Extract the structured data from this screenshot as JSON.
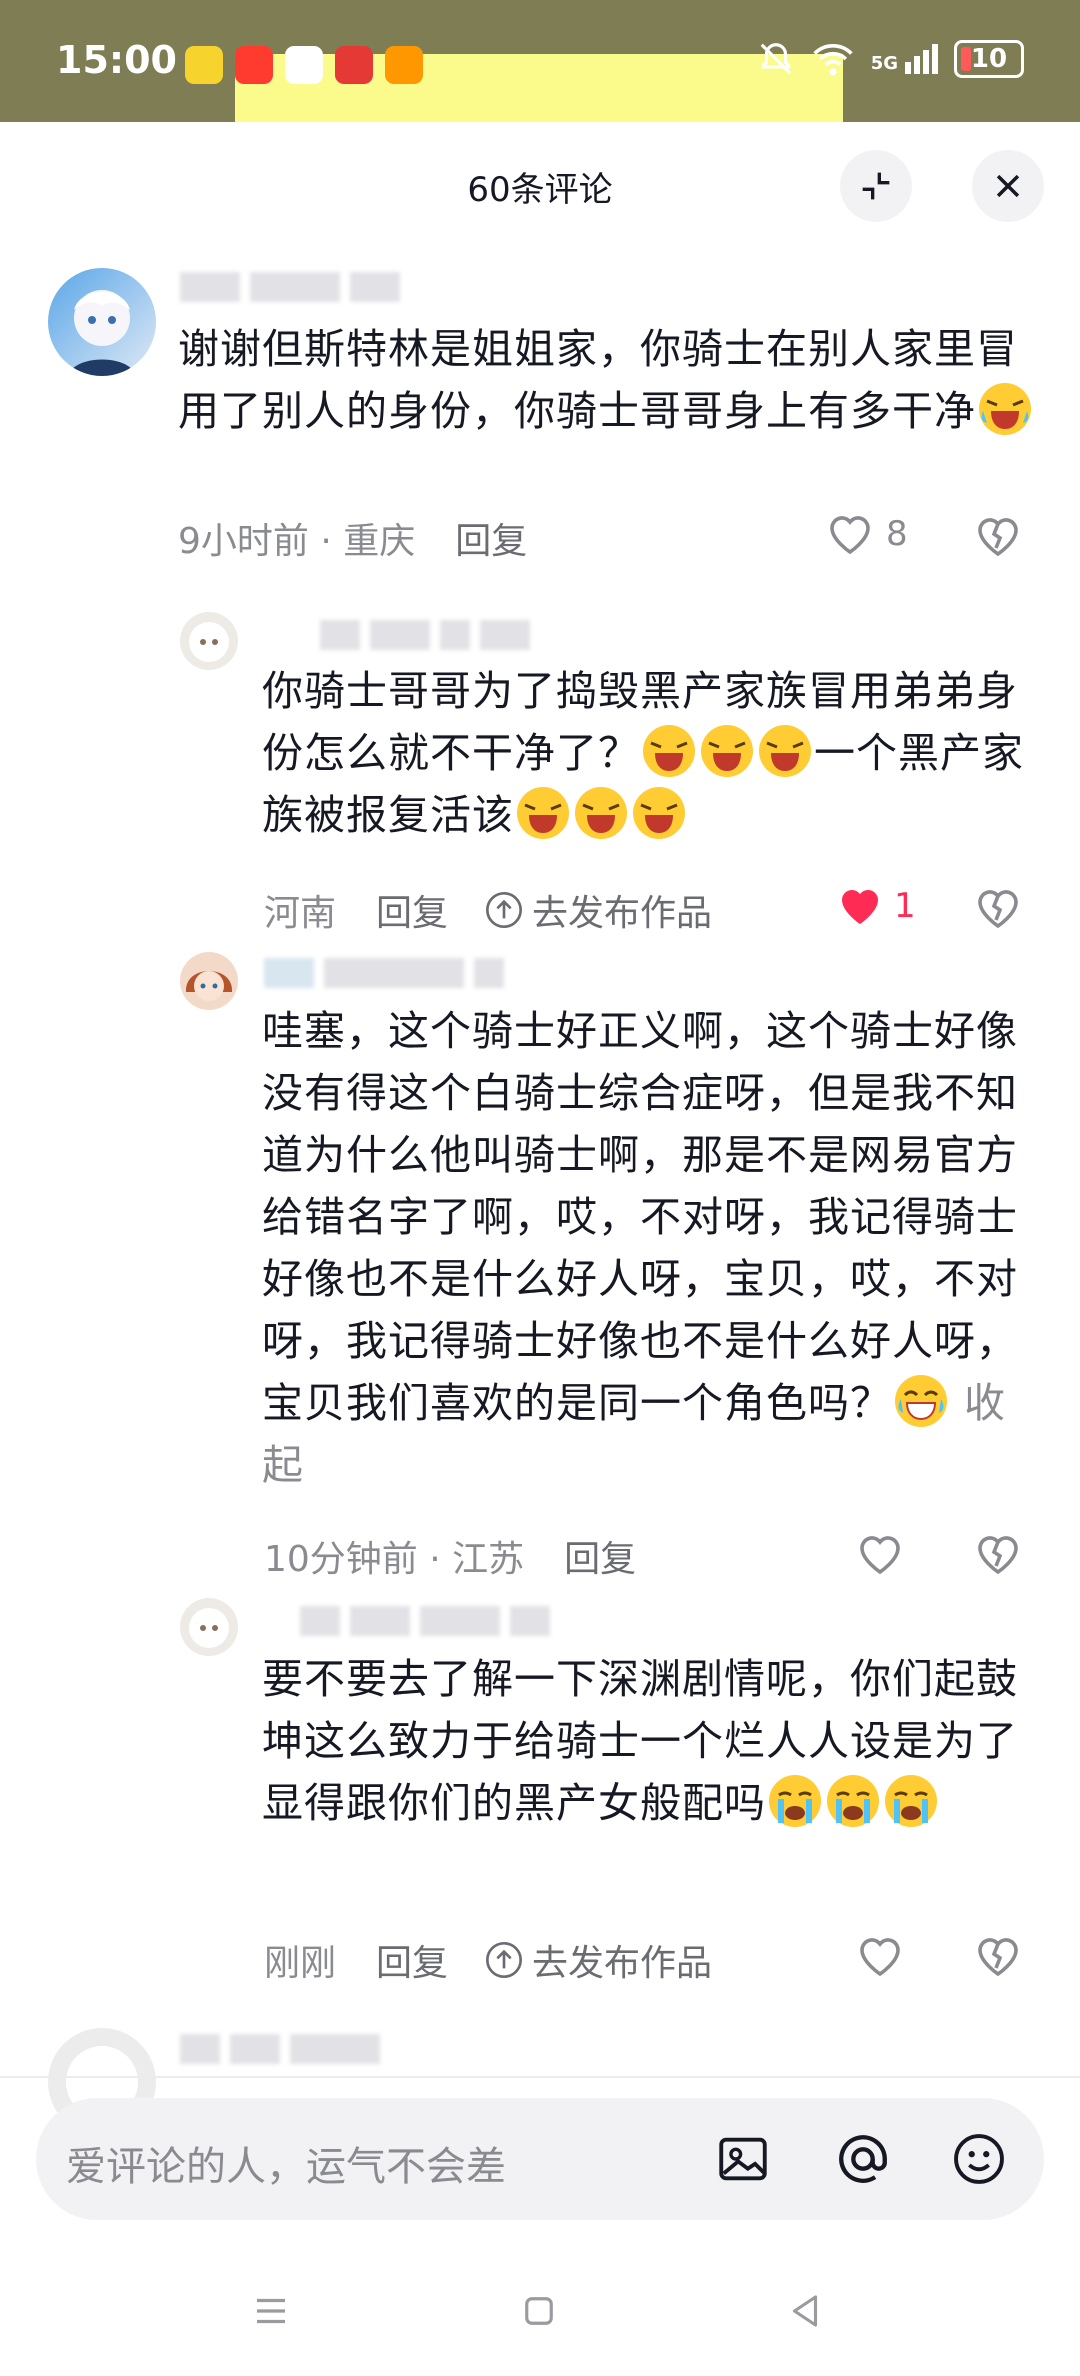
{
  "status_bar": {
    "time": "15:00",
    "network": "5G",
    "battery": "10",
    "app_icon_colors": [
      "#f6d32d",
      "#ff3b30",
      "#1e88e5",
      "#e53935",
      "#ff9800"
    ]
  },
  "sheet": {
    "title": "60条评论"
  },
  "comments": [
    {
      "text_parts": [
        "谢谢但斯特林是姐姐家，你骑士在别人家里冒用了别人的身份，你骑士哥哥身上有多干净"
      ],
      "time_location": "9小时前 · 重庆",
      "reply_label": "回复",
      "like_count": "8",
      "emoji": "laughing-crying-emoji"
    },
    {
      "text_part1": "你骑士哥哥为了捣毁黑产家族冒用弟弟身份怎么就不干净了？",
      "text_part2": "一个黑产家族被报复活该",
      "location": "河南",
      "reply_label": "回复",
      "publish_label": "去发布作品",
      "like_count": "1"
    },
    {
      "text": "哇塞，这个骑士好正义啊，这个骑士好像没有得这个白骑士综合症呀，但是我不知道为什么他叫骑士啊，那是不是网易官方给错名字了啊，哎，不对呀，我记得骑士好像也不是什么好人呀，宝贝，哎，不对呀，我记得骑士好像也不是什么好人呀，宝贝我们喜欢的是同一个角色吗？",
      "collapse_label": "收起",
      "time_location": "10分钟前 · 江苏",
      "reply_label": "回复"
    },
    {
      "text": "要不要去了解一下深渊剧情呢，你们起鼓坤这么致力于给骑士一个烂人人设是为了显得跟你们的黑产女般配吗",
      "time": "刚刚",
      "reply_label": "回复",
      "publish_label": "去发布作品"
    }
  ],
  "input": {
    "placeholder": "爱评论的人，运气不会差"
  }
}
